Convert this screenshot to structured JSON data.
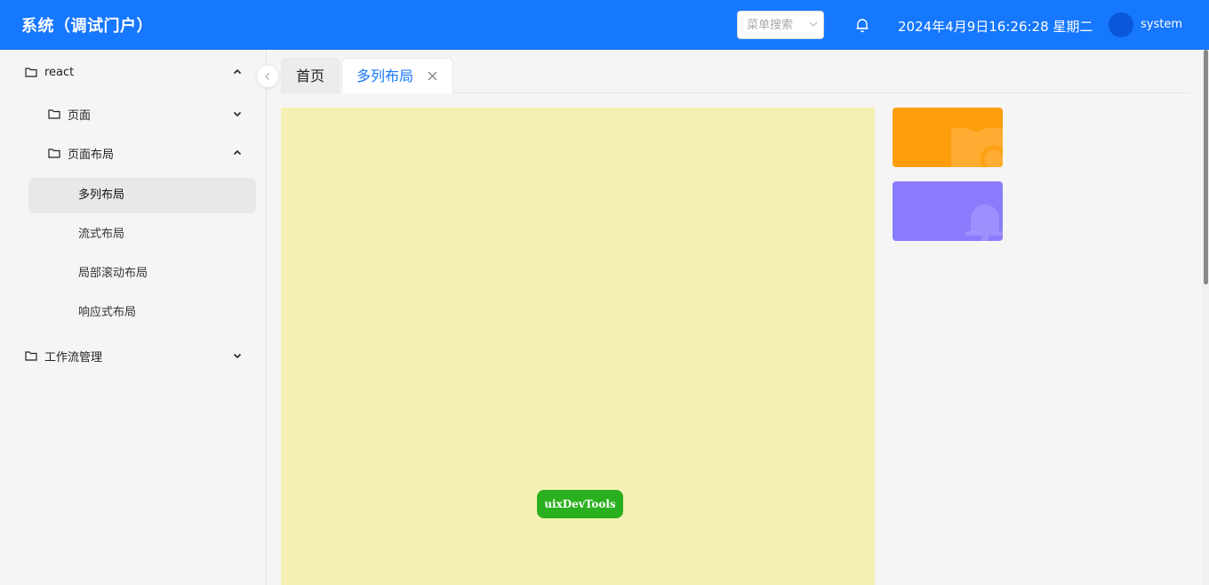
{
  "header": {
    "app_title": "系统（调试门户）",
    "menu_search_placeholder": "菜单搜索",
    "datetime": "2024年4月9日16:26:28 星期二",
    "username": "system",
    "bg_color": "#1677ff"
  },
  "sidebar": {
    "groups": [
      {
        "label": "react",
        "expanded": true
      },
      {
        "label": "页面",
        "expanded": false
      },
      {
        "label": "页面布局",
        "expanded": true
      },
      {
        "label": "工作流管理",
        "expanded": false
      }
    ],
    "items": [
      {
        "label": "多列布局",
        "active": true
      },
      {
        "label": "流式布局",
        "active": false
      },
      {
        "label": "局部滚动布局",
        "active": false
      },
      {
        "label": "响应式布局",
        "active": false
      }
    ]
  },
  "tabs": [
    {
      "label": "首页",
      "active": false
    },
    {
      "label": "多列布局",
      "active": true,
      "closable": true
    }
  ],
  "content": {
    "main_panel_color": "#f5f0b4",
    "cards": [
      {
        "color": "#fe9e0c",
        "icon": "book-icon"
      },
      {
        "color": "#8a7cfc",
        "icon": "bell-icon"
      }
    ]
  },
  "devtools": {
    "label": "uixDevTools",
    "color": "#2ab01e"
  }
}
